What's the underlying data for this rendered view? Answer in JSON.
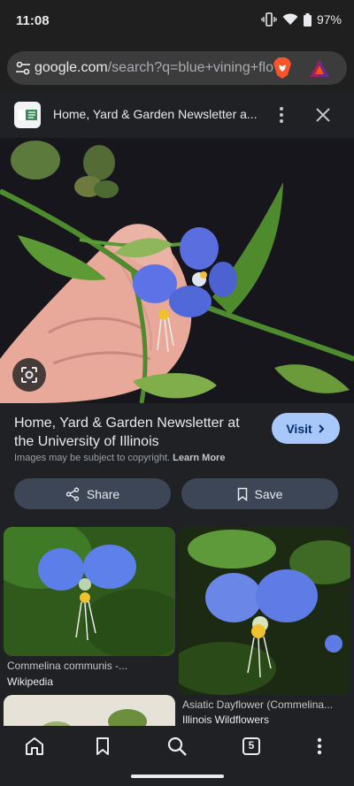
{
  "status": {
    "time": "11:08",
    "battery": "97%"
  },
  "url": {
    "host": "google.com",
    "path": "/search?q=blue+vining+flo"
  },
  "source_bar": {
    "title": "Home, Yard & Garden Newsletter a..."
  },
  "hero": {
    "lens_icon": "lens-icon"
  },
  "result": {
    "heading": "Home, Yard & Garden Newsletter at the University of Illinois",
    "visit_label": "Visit",
    "copyright_text": "Images may be subject to copyright.",
    "learn_more": "Learn More",
    "share_label": "Share",
    "save_label": "Save"
  },
  "related": [
    {
      "caption": "Commelina communis -...",
      "source": "Wikipedia"
    },
    {
      "caption": "Asiatic Dayflower (Commelina...",
      "source": "Illinois Wildflowers"
    }
  ],
  "navbar": {
    "tab_count": "5"
  },
  "colors": {
    "accent": "#a8c7fa",
    "button_bg": "#3c4656",
    "background": "#202124"
  }
}
